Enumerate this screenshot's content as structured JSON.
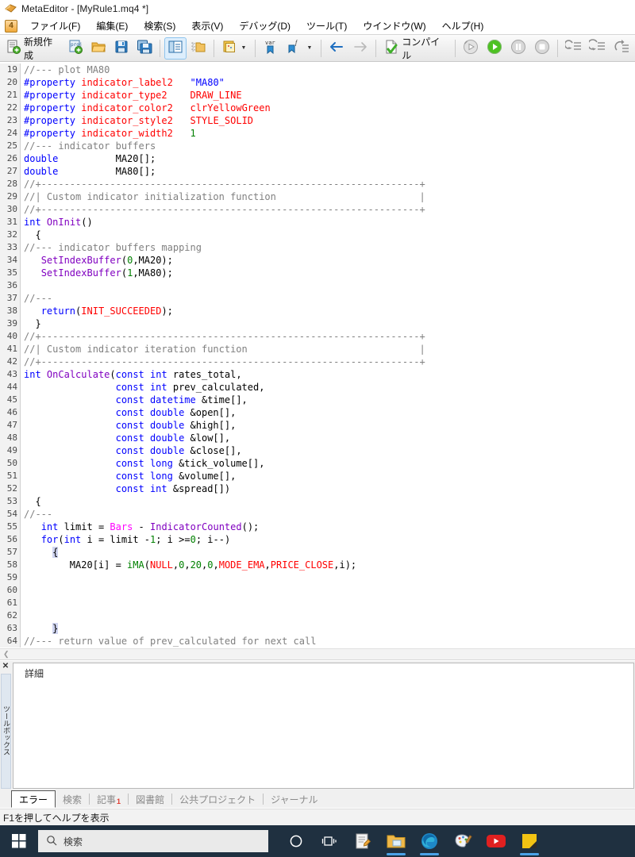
{
  "window": {
    "app_icon": "metaeditor-diamond-icon",
    "title": "MetaEditor - [MyRule1.mq4 *]"
  },
  "menubar": {
    "app_badge": "4",
    "items": [
      {
        "name": "file",
        "label": "ファイル(F)"
      },
      {
        "name": "edit",
        "label": "編集(E)"
      },
      {
        "name": "search",
        "label": "検索(S)"
      },
      {
        "name": "view",
        "label": "表示(V)"
      },
      {
        "name": "debug",
        "label": "デバッグ(D)"
      },
      {
        "name": "tools",
        "label": "ツール(T)"
      },
      {
        "name": "window",
        "label": "ウインドウ(W)"
      },
      {
        "name": "help",
        "label": "ヘルプ(H)"
      }
    ]
  },
  "toolbar": {
    "new_label": "新規作成",
    "compile_label": "コンパイル",
    "buttons": [
      {
        "name": "new-file-button",
        "icon": "new-document-icon"
      },
      {
        "name": "new-project-button",
        "icon": "project-add-icon"
      },
      {
        "name": "open-button",
        "icon": "folder-open-icon"
      },
      {
        "name": "save-button",
        "icon": "floppy-save-icon"
      },
      {
        "name": "save-all-button",
        "icon": "floppy-save-all-icon"
      },
      {
        "name": "navigator-button",
        "icon": "panel-toggle-icon"
      },
      {
        "name": "toolbox-button",
        "icon": "folder-dotted-icon"
      },
      {
        "name": "properties-button",
        "icon": "notes-palette-icon"
      },
      {
        "name": "insert-variable-button",
        "icon": "var-bookmark-icon"
      },
      {
        "name": "insert-function-button",
        "icon": "function-bookmark-icon"
      },
      {
        "name": "back-button",
        "icon": "arrow-left-icon"
      },
      {
        "name": "forward-button",
        "icon": "arrow-right-icon"
      },
      {
        "name": "compile-button",
        "icon": "compile-check-icon"
      },
      {
        "name": "debug-history-button",
        "icon": "debug-rewind-icon"
      },
      {
        "name": "run-button",
        "icon": "play-green-icon"
      },
      {
        "name": "pause-button",
        "icon": "pause-icon"
      },
      {
        "name": "stop-button",
        "icon": "stop-icon"
      },
      {
        "name": "step-into-button",
        "icon": "step-into-icon"
      },
      {
        "name": "step-over-button",
        "icon": "step-over-icon"
      },
      {
        "name": "step-out-button",
        "icon": "step-out-icon"
      }
    ]
  },
  "editor": {
    "first_line_number": 19,
    "lines": [
      {
        "n": 19,
        "tokens": [
          {
            "t": "//--- plot MA80",
            "c": "cm"
          }
        ]
      },
      {
        "n": 20,
        "tokens": [
          {
            "t": "#property",
            "c": "pp"
          },
          {
            "t": " ",
            "c": "id"
          },
          {
            "t": "indicator_label2",
            "c": "pn"
          },
          {
            "t": "   ",
            "c": "id"
          },
          {
            "t": "\"MA80\"",
            "c": "str"
          }
        ]
      },
      {
        "n": 21,
        "tokens": [
          {
            "t": "#property",
            "c": "pp"
          },
          {
            "t": " ",
            "c": "id"
          },
          {
            "t": "indicator_type2",
            "c": "pn"
          },
          {
            "t": "    ",
            "c": "id"
          },
          {
            "t": "DRAW_LINE",
            "c": "cst"
          }
        ]
      },
      {
        "n": 22,
        "tokens": [
          {
            "t": "#property",
            "c": "pp"
          },
          {
            "t": " ",
            "c": "id"
          },
          {
            "t": "indicator_color2",
            "c": "pn"
          },
          {
            "t": "   ",
            "c": "id"
          },
          {
            "t": "clrYellowGreen",
            "c": "cst"
          }
        ]
      },
      {
        "n": 23,
        "tokens": [
          {
            "t": "#property",
            "c": "pp"
          },
          {
            "t": " ",
            "c": "id"
          },
          {
            "t": "indicator_style2",
            "c": "pn"
          },
          {
            "t": "   ",
            "c": "id"
          },
          {
            "t": "STYLE_SOLID",
            "c": "cst"
          }
        ]
      },
      {
        "n": 24,
        "tokens": [
          {
            "t": "#property",
            "c": "pp"
          },
          {
            "t": " ",
            "c": "id"
          },
          {
            "t": "indicator_width2",
            "c": "pn"
          },
          {
            "t": "   ",
            "c": "id"
          },
          {
            "t": "1",
            "c": "num"
          }
        ]
      },
      {
        "n": 25,
        "tokens": [
          {
            "t": "//--- indicator buffers",
            "c": "cm"
          }
        ]
      },
      {
        "n": 26,
        "tokens": [
          {
            "t": "double",
            "c": "k"
          },
          {
            "t": "          MA20[];",
            "c": "id"
          }
        ]
      },
      {
        "n": 27,
        "tokens": [
          {
            "t": "double",
            "c": "k"
          },
          {
            "t": "          MA80[];",
            "c": "id"
          }
        ]
      },
      {
        "n": 28,
        "tokens": [
          {
            "t": "//+------------------------------------------------------------------+",
            "c": "cm"
          }
        ]
      },
      {
        "n": 29,
        "tokens": [
          {
            "t": "//| Custom indicator initialization function                         |",
            "c": "cm"
          }
        ]
      },
      {
        "n": 30,
        "tokens": [
          {
            "t": "//+------------------------------------------------------------------+",
            "c": "cm"
          }
        ]
      },
      {
        "n": 31,
        "tokens": [
          {
            "t": "int",
            "c": "k"
          },
          {
            "t": " ",
            "c": "id"
          },
          {
            "t": "OnInit",
            "c": "fn"
          },
          {
            "t": "()",
            "c": "id"
          }
        ]
      },
      {
        "n": 32,
        "tokens": [
          {
            "t": "  {",
            "c": "id"
          }
        ]
      },
      {
        "n": 33,
        "tokens": [
          {
            "t": "//--- indicator buffers mapping",
            "c": "cm"
          }
        ]
      },
      {
        "n": 34,
        "tokens": [
          {
            "t": "   ",
            "c": "id"
          },
          {
            "t": "SetIndexBuffer",
            "c": "fn"
          },
          {
            "t": "(",
            "c": "id"
          },
          {
            "t": "0",
            "c": "num"
          },
          {
            "t": ",MA20);",
            "c": "id"
          }
        ]
      },
      {
        "n": 35,
        "tokens": [
          {
            "t": "   ",
            "c": "id"
          },
          {
            "t": "SetIndexBuffer",
            "c": "fn"
          },
          {
            "t": "(",
            "c": "id"
          },
          {
            "t": "1",
            "c": "num"
          },
          {
            "t": ",MA80);",
            "c": "id"
          }
        ]
      },
      {
        "n": 36,
        "tokens": [
          {
            "t": "",
            "c": "id"
          }
        ]
      },
      {
        "n": 37,
        "tokens": [
          {
            "t": "//---",
            "c": "cm"
          }
        ]
      },
      {
        "n": 38,
        "tokens": [
          {
            "t": "   ",
            "c": "id"
          },
          {
            "t": "return",
            "c": "k"
          },
          {
            "t": "(",
            "c": "id"
          },
          {
            "t": "INIT_SUCCEEDED",
            "c": "cst"
          },
          {
            "t": ");",
            "c": "id"
          }
        ]
      },
      {
        "n": 39,
        "tokens": [
          {
            "t": "  }",
            "c": "id"
          }
        ]
      },
      {
        "n": 40,
        "tokens": [
          {
            "t": "//+------------------------------------------------------------------+",
            "c": "cm"
          }
        ]
      },
      {
        "n": 41,
        "tokens": [
          {
            "t": "//| Custom indicator iteration function                              |",
            "c": "cm"
          }
        ]
      },
      {
        "n": 42,
        "tokens": [
          {
            "t": "//+------------------------------------------------------------------+",
            "c": "cm"
          }
        ]
      },
      {
        "n": 43,
        "tokens": [
          {
            "t": "int",
            "c": "k"
          },
          {
            "t": " ",
            "c": "id"
          },
          {
            "t": "OnCalculate",
            "c": "fn"
          },
          {
            "t": "(",
            "c": "id"
          },
          {
            "t": "const int",
            "c": "k"
          },
          {
            "t": " rates_total,",
            "c": "id"
          }
        ]
      },
      {
        "n": 44,
        "tokens": [
          {
            "t": "                ",
            "c": "id"
          },
          {
            "t": "const int",
            "c": "k"
          },
          {
            "t": " prev_calculated,",
            "c": "id"
          }
        ]
      },
      {
        "n": 45,
        "tokens": [
          {
            "t": "                ",
            "c": "id"
          },
          {
            "t": "const datetime",
            "c": "k"
          },
          {
            "t": " &time[],",
            "c": "id"
          }
        ]
      },
      {
        "n": 46,
        "tokens": [
          {
            "t": "                ",
            "c": "id"
          },
          {
            "t": "const double",
            "c": "k"
          },
          {
            "t": " &open[],",
            "c": "id"
          }
        ]
      },
      {
        "n": 47,
        "tokens": [
          {
            "t": "                ",
            "c": "id"
          },
          {
            "t": "const double",
            "c": "k"
          },
          {
            "t": " &high[],",
            "c": "id"
          }
        ]
      },
      {
        "n": 48,
        "tokens": [
          {
            "t": "                ",
            "c": "id"
          },
          {
            "t": "const double",
            "c": "k"
          },
          {
            "t": " &low[],",
            "c": "id"
          }
        ]
      },
      {
        "n": 49,
        "tokens": [
          {
            "t": "                ",
            "c": "id"
          },
          {
            "t": "const double",
            "c": "k"
          },
          {
            "t": " &close[],",
            "c": "id"
          }
        ]
      },
      {
        "n": 50,
        "tokens": [
          {
            "t": "                ",
            "c": "id"
          },
          {
            "t": "const long",
            "c": "k"
          },
          {
            "t": " &tick_volume[],",
            "c": "id"
          }
        ]
      },
      {
        "n": 51,
        "tokens": [
          {
            "t": "                ",
            "c": "id"
          },
          {
            "t": "const long",
            "c": "k"
          },
          {
            "t": " &volume[],",
            "c": "id"
          }
        ]
      },
      {
        "n": 52,
        "tokens": [
          {
            "t": "                ",
            "c": "id"
          },
          {
            "t": "const int",
            "c": "k"
          },
          {
            "t": " &spread[])",
            "c": "id"
          }
        ]
      },
      {
        "n": 53,
        "tokens": [
          {
            "t": "  {",
            "c": "id"
          }
        ]
      },
      {
        "n": 54,
        "tokens": [
          {
            "t": "//---",
            "c": "cm"
          }
        ]
      },
      {
        "n": 55,
        "tokens": [
          {
            "t": "   ",
            "c": "id"
          },
          {
            "t": "int",
            "c": "k"
          },
          {
            "t": " limit = ",
            "c": "id"
          },
          {
            "t": "Bars",
            "c": "var"
          },
          {
            "t": " - ",
            "c": "id"
          },
          {
            "t": "IndicatorCounted",
            "c": "fn"
          },
          {
            "t": "();",
            "c": "id"
          }
        ]
      },
      {
        "n": 56,
        "tokens": [
          {
            "t": "   ",
            "c": "id"
          },
          {
            "t": "for",
            "c": "k"
          },
          {
            "t": "(",
            "c": "id"
          },
          {
            "t": "int",
            "c": "k"
          },
          {
            "t": " i = limit -",
            "c": "id"
          },
          {
            "t": "1",
            "c": "num"
          },
          {
            "t": "; i >=",
            "c": "id"
          },
          {
            "t": "0",
            "c": "num"
          },
          {
            "t": "; i--)",
            "c": "id"
          }
        ]
      },
      {
        "n": 57,
        "tokens": [
          {
            "t": "     ",
            "c": "id"
          },
          {
            "t": "{",
            "c": "brace-hl"
          }
        ]
      },
      {
        "n": 58,
        "tokens": [
          {
            "t": "        MA20[i] = ",
            "c": "id"
          },
          {
            "t": "iMA",
            "c": "fng"
          },
          {
            "t": "(",
            "c": "id"
          },
          {
            "t": "NULL",
            "c": "cst"
          },
          {
            "t": ",",
            "c": "id"
          },
          {
            "t": "0",
            "c": "num"
          },
          {
            "t": ",",
            "c": "id"
          },
          {
            "t": "20",
            "c": "num"
          },
          {
            "t": ",",
            "c": "id"
          },
          {
            "t": "0",
            "c": "num"
          },
          {
            "t": ",",
            "c": "id"
          },
          {
            "t": "MODE_EMA",
            "c": "cst"
          },
          {
            "t": ",",
            "c": "id"
          },
          {
            "t": "PRICE_CLOSE",
            "c": "cst"
          },
          {
            "t": ",i);",
            "c": "id"
          }
        ]
      },
      {
        "n": 59,
        "tokens": [
          {
            "t": "",
            "c": "id"
          }
        ]
      },
      {
        "n": 60,
        "tokens": [
          {
            "t": "",
            "c": "id"
          }
        ]
      },
      {
        "n": 61,
        "tokens": [
          {
            "t": "",
            "c": "id"
          }
        ]
      },
      {
        "n": 62,
        "tokens": [
          {
            "t": "",
            "c": "id"
          }
        ]
      },
      {
        "n": 63,
        "tokens": [
          {
            "t": "     ",
            "c": "id"
          },
          {
            "t": "}",
            "c": "brace-hl"
          }
        ]
      },
      {
        "n": 64,
        "tokens": [
          {
            "t": "//--- return value of prev_calculated for next call",
            "c": "cm"
          }
        ]
      }
    ]
  },
  "toolbox": {
    "close_glyph": "✕",
    "vertical_tab_label": "ツールボックス",
    "detail_label": "詳細",
    "tabs": [
      {
        "name": "errors",
        "label": "エラー",
        "selected": true,
        "badge": ""
      },
      {
        "name": "search",
        "label": "検索",
        "selected": false,
        "badge": ""
      },
      {
        "name": "articles",
        "label": "記事",
        "selected": false,
        "badge": "1"
      },
      {
        "name": "library",
        "label": "図書館",
        "selected": false,
        "badge": ""
      },
      {
        "name": "public-projects",
        "label": "公共プロジェクト",
        "selected": false,
        "badge": ""
      },
      {
        "name": "journal",
        "label": "ジャーナル",
        "selected": false,
        "badge": ""
      }
    ]
  },
  "statusbar": {
    "hint": "F1を押してヘルプを表示"
  },
  "taskbar": {
    "search_placeholder": "検索",
    "icons": [
      {
        "name": "cortana-icon",
        "running": false
      },
      {
        "name": "task-view-icon",
        "running": false
      },
      {
        "name": "notepad-icon",
        "running": false
      },
      {
        "name": "file-explorer-icon",
        "running": true
      },
      {
        "name": "microsoft-edge-icon",
        "running": true
      },
      {
        "name": "paint-icon",
        "running": false
      },
      {
        "name": "youtube-icon",
        "running": false
      },
      {
        "name": "metaeditor-taskbar-icon",
        "running": true
      }
    ]
  },
  "colors": {
    "accent_blue": "#0000ff",
    "comment_gray": "#808080",
    "constant_red": "#ff0000",
    "number_green": "#008000",
    "function_purple": "#8000c0",
    "predefined_magenta": "#ff00ff",
    "taskbar_bg": "#1f3040",
    "badge_red": "#e03b2f"
  }
}
